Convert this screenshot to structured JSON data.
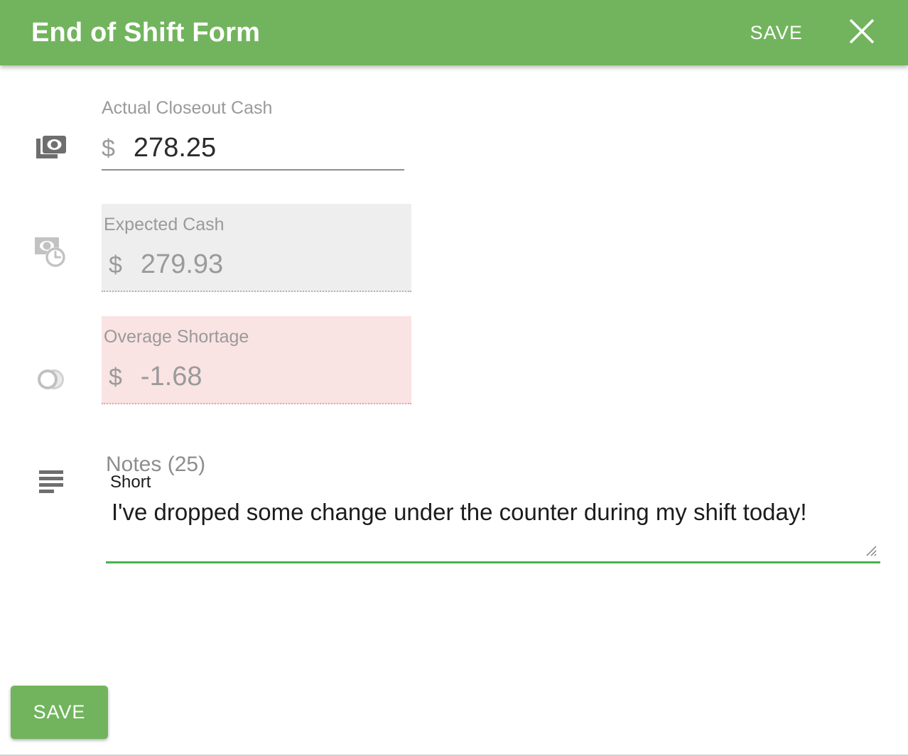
{
  "window": {
    "title": "End of Shift Form",
    "header_save_label": "SAVE",
    "close_icon": "close-x-icon",
    "accent_color": "#71b45d",
    "error_color": "#fae3e3"
  },
  "fields": [
    {
      "icon": "banknote-icon",
      "label": "Actual Closeout Cash",
      "currency_symbol": "$",
      "value": "278.25",
      "state": "editable"
    },
    {
      "icon": "banknote-clock-icon",
      "label": "Expected Cash",
      "currency_symbol": "$",
      "value": "279.93",
      "state": "readonly"
    },
    {
      "icon": "overlapping-coins-icon",
      "label": "Overage Shortage",
      "currency_symbol": "$",
      "value": "-1.68",
      "state": "error",
      "helper_text": "Short"
    }
  ],
  "notes": {
    "icon": "text-lines-icon",
    "label": "Notes (25)",
    "value": "I've dropped some change under the counter during my shift today!",
    "placeholder": "",
    "focused": true
  },
  "footer": {
    "save_label": "SAVE"
  }
}
